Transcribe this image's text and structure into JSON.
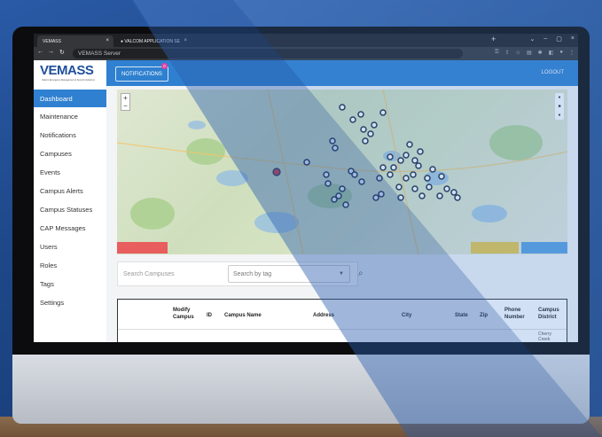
{
  "browser": {
    "tabs": [
      {
        "label": "VEMASS"
      },
      {
        "label": "VALCOM APPLICATION SE"
      }
    ],
    "url": "VEMASS Server"
  },
  "header": {
    "logo_primary": "VEMASS",
    "tagline": "Valcom Emergency Management & Security Solutions",
    "notifications_label": "NOTIFICATIONS",
    "notifications_count": "0",
    "logout_label": "LOGOUT"
  },
  "sidebar": {
    "items": [
      {
        "label": "Dashboard",
        "active": true
      },
      {
        "label": "Maintenance"
      },
      {
        "label": "Notifications"
      },
      {
        "label": "Campuses"
      },
      {
        "label": "Events"
      },
      {
        "label": "Campus Alerts"
      },
      {
        "label": "Campus Statuses"
      },
      {
        "label": "CAP Messages"
      },
      {
        "label": "Users"
      },
      {
        "label": "Roles"
      },
      {
        "label": "Tags"
      },
      {
        "label": "Settings"
      }
    ]
  },
  "search": {
    "campus_placeholder": "Search Campuses",
    "tag_placeholder": "Search by tag"
  },
  "table": {
    "headers": [
      "Modify Campus",
      "ID",
      "Campus Name",
      "Address",
      "City",
      "State",
      "Zip",
      "Phone Number",
      "Campus District"
    ],
    "first_row": {
      "district": "Cherry Creek"
    }
  },
  "colors": {
    "primary": "#2f80d0",
    "logo_blue": "#1f4f9c",
    "logo_red": "#d8353a",
    "alert_red": "#e85d5d"
  }
}
